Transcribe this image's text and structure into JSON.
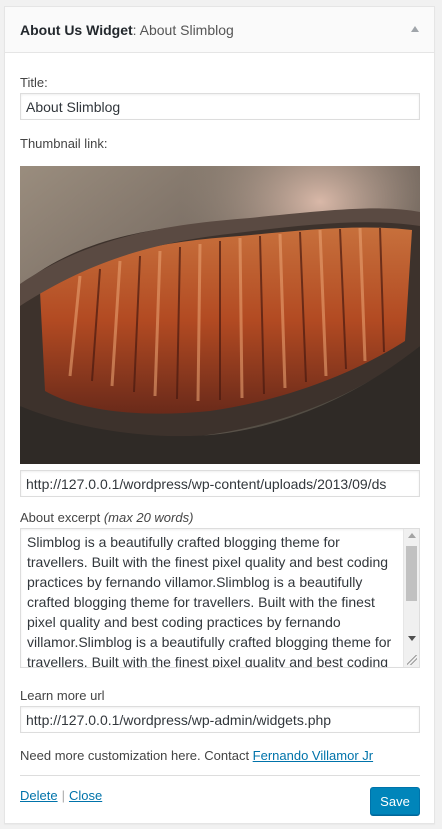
{
  "widget": {
    "title": "About Us Widget",
    "title_suffix": ": About Slimblog"
  },
  "form": {
    "title_label": "Title:",
    "title_value": "About Slimblog",
    "thumbnail_label": "Thumbnail link:",
    "thumbnail_url": "http://127.0.0.1/wordpress/wp-content/uploads/2013/09/ds",
    "excerpt_label": "About excerpt",
    "excerpt_hint": "(max 20 words)",
    "excerpt_value": "Slimblog is a beautifully crafted blogging theme for travellers. Built with the finest pixel quality and best coding practices by fernando villamor.Slimblog is a beautifully crafted blogging theme for travellers. Built with the finest pixel quality and best coding practices by fernando villamor.Slimblog is a beautifully crafted blogging theme for travellers. Built with the finest pixel quality and best coding practices by fernando villamor.",
    "learn_more_label": "Learn more url",
    "learn_more_value": "http://127.0.0.1/wordpress/wp-admin/widgets.php",
    "help_text": "Need more customization here. Contact ",
    "help_link": "Fernando Villamor Jr"
  },
  "actions": {
    "delete": "Delete",
    "separator": "|",
    "close": "Close",
    "save": "Save"
  },
  "colors": {
    "primary": "#0085ba",
    "link": "#0073aa"
  },
  "icons": {
    "toggle": "arrow-up-icon"
  }
}
